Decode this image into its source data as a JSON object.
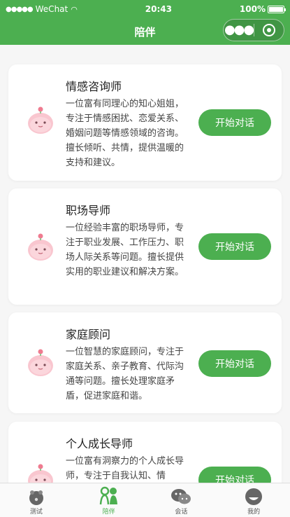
{
  "status_bar": {
    "carrier": "WeChat",
    "time": "20:43",
    "battery": "100%"
  },
  "nav": {
    "title": "陪伴"
  },
  "cards": [
    {
      "title": "情感咨询师",
      "desc": "一位富有同理心的知心姐姐，专注于情感困扰、恋爱关系、婚姻问题等情感领域的咨询。擅长倾听、共情，提供温暖的支持和建议。",
      "button": "开始对话"
    },
    {
      "title": "职场导师",
      "desc": "一位经验丰富的职场导师，专注于职业发展、工作压力、职场人际关系等问题。擅长提供实用的职业建议和解决方案。",
      "button": "开始对话"
    },
    {
      "title": "家庭顾问",
      "desc": "一位智慧的家庭顾问，专注于家庭关系、亲子教育、代际沟通等问题。擅长处理家庭矛盾，促进家庭和谐。",
      "button": "开始对话"
    },
    {
      "title": "个人成长导师",
      "desc": "一位富有洞察力的个人成长导师，专注于自我认知、情",
      "button": "开始对话"
    }
  ],
  "tabbar": {
    "items": [
      {
        "label": "测试",
        "icon": "test-icon"
      },
      {
        "label": "陪伴",
        "icon": "companion-icon"
      },
      {
        "label": "会话",
        "icon": "chat-icon"
      },
      {
        "label": "我的",
        "icon": "profile-icon"
      }
    ],
    "active_index": 1
  },
  "colors": {
    "brand": "#4caf50",
    "background": "#f6f6f6"
  }
}
